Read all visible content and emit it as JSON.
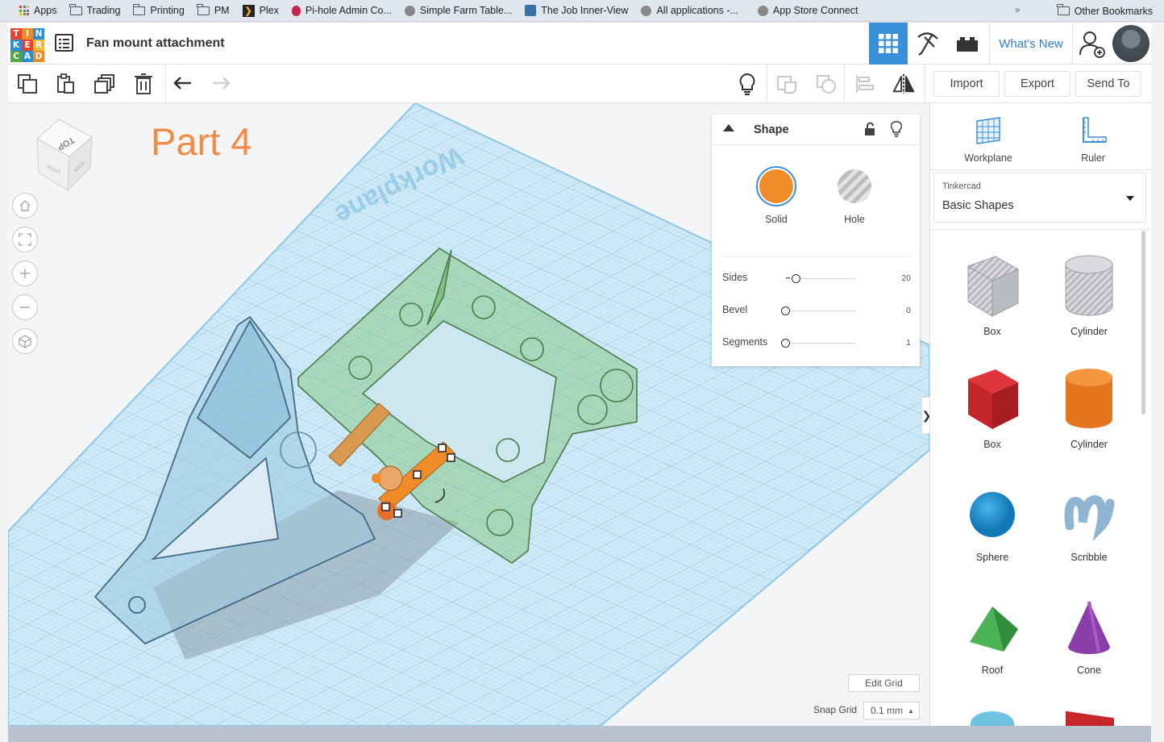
{
  "bookmarks": [
    {
      "label": "Apps",
      "icon": "apps-grid-icon"
    },
    {
      "label": "Trading",
      "icon": "folder-icon"
    },
    {
      "label": "Printing",
      "icon": "folder-icon"
    },
    {
      "label": "PM",
      "icon": "folder-icon"
    },
    {
      "label": "Plex",
      "icon": "plex-icon"
    },
    {
      "label": "Pi-hole Admin Co...",
      "icon": "raspberry-icon"
    },
    {
      "label": "Simple Farm Table...",
      "icon": "globe-icon"
    },
    {
      "label": "The Job Inner-View",
      "icon": "site-icon"
    },
    {
      "label": "All applications -...",
      "icon": "globe-icon"
    },
    {
      "label": "App Store Connect",
      "icon": "globe-icon"
    }
  ],
  "bookmarks_more": "»",
  "other_bookmarks": "Other Bookmarks",
  "header": {
    "logo_letters": [
      "T",
      "I",
      "N",
      "K",
      "E",
      "R",
      "C",
      "A",
      "D"
    ],
    "logo_colors": [
      "#e8432d",
      "#f08c28",
      "#2a8fd6",
      "#2a8fd6",
      "#e8432d",
      "#f0b93a",
      "#55a745",
      "#2a8fd6",
      "#f08c28"
    ],
    "title": "Fan mount attachment",
    "whats_new": "What's New"
  },
  "toolbar": {
    "import": "Import",
    "export": "Export",
    "send_to": "Send To"
  },
  "canvas": {
    "part_label": "Part 4",
    "workplane_text": "Workplane",
    "viewcube_top": "TOP",
    "viewcube_right": "RIGHT",
    "viewcube_back": "BACK"
  },
  "inspector": {
    "title": "Shape",
    "solid_label": "Solid",
    "hole_label": "Hole",
    "properties": [
      {
        "label": "Sides",
        "value": "20",
        "fraction": 0.15
      },
      {
        "label": "Bevel",
        "value": "0",
        "fraction": 0.0
      },
      {
        "label": "Segments",
        "value": "1",
        "fraction": 0.0
      }
    ]
  },
  "grid": {
    "edit_grid": "Edit Grid",
    "snap_label": "Snap Grid",
    "snap_value": "0.1 mm"
  },
  "right_panel": {
    "workplane": "Workplane",
    "ruler": "Ruler",
    "library_caption": "Tinkercad",
    "library_value": "Basic Shapes",
    "shapes": [
      {
        "label": "Box",
        "kind": "box-hole"
      },
      {
        "label": "Cylinder",
        "kind": "cylinder-hole"
      },
      {
        "label": "Box",
        "kind": "box-red"
      },
      {
        "label": "Cylinder",
        "kind": "cylinder-orange"
      },
      {
        "label": "Sphere",
        "kind": "sphere-blue"
      },
      {
        "label": "Scribble",
        "kind": "scribble"
      },
      {
        "label": "Roof",
        "kind": "roof-green"
      },
      {
        "label": "Cone",
        "kind": "cone-purple"
      }
    ]
  },
  "colors": {
    "accent_blue": "#2a8fd6",
    "part_orange": "#f28b45",
    "solid_orange": "#f08c28",
    "grid_blue": "#bfe0f2"
  }
}
